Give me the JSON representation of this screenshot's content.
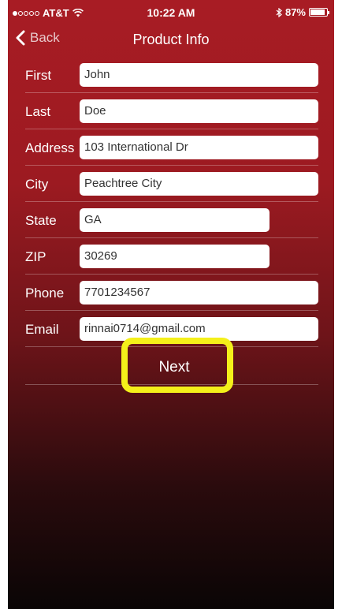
{
  "status_bar": {
    "carrier": "AT&T",
    "time": "10:22 AM",
    "battery": "87%"
  },
  "nav": {
    "back_label": "Back",
    "title": "Product Info"
  },
  "form": {
    "first": {
      "label": "First",
      "value": "John"
    },
    "last": {
      "label": "Last",
      "value": "Doe"
    },
    "address": {
      "label": "Address",
      "value": "103 International Dr"
    },
    "city": {
      "label": "City",
      "value": "Peachtree City"
    },
    "state": {
      "label": "State",
      "value": "GA"
    },
    "zip": {
      "label": "ZIP",
      "value": "30269"
    },
    "phone": {
      "label": "Phone",
      "value": "7701234567"
    },
    "email": {
      "label": "Email",
      "value": "rinnai0714@gmail.com"
    }
  },
  "next_label": "Next",
  "colors": {
    "header_red": "#a81c24",
    "highlight": "#f4f01a"
  }
}
